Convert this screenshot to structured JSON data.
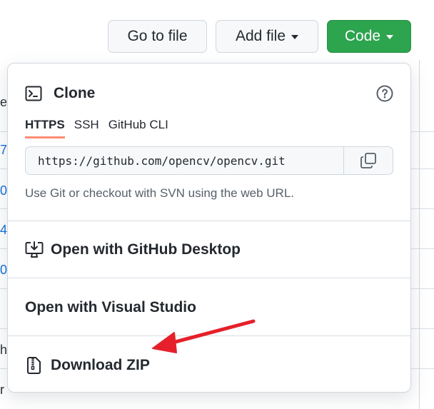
{
  "toolbar": {
    "go_to_file": "Go to file",
    "add_file": "Add file",
    "code": "Code"
  },
  "clone": {
    "title": "Clone",
    "tabs": [
      "HTTPS",
      "SSH",
      "GitHub CLI"
    ],
    "active_tab": "HTTPS",
    "url": "https://github.com/opencv/opencv.git",
    "hint": "Use Git or checkout with SVN using the web URL."
  },
  "menu": {
    "desktop": "Open with GitHub Desktop",
    "visual_studio": "Open with Visual Studio",
    "download_zip": "Download ZIP"
  },
  "background_chars": [
    "e",
    "7",
    "0",
    "4",
    "0",
    "h",
    "r"
  ],
  "colors": {
    "primary_green": "#2da44e",
    "active_tab_underline": "#fd8c73",
    "annotation_arrow": "#e5202a",
    "link_blue": "#0969da"
  },
  "icons": {
    "clone": "terminal-icon",
    "help": "question-circle-icon",
    "copy": "copy-icon",
    "desktop": "desktop-download-icon",
    "zip": "file-zip-icon"
  }
}
